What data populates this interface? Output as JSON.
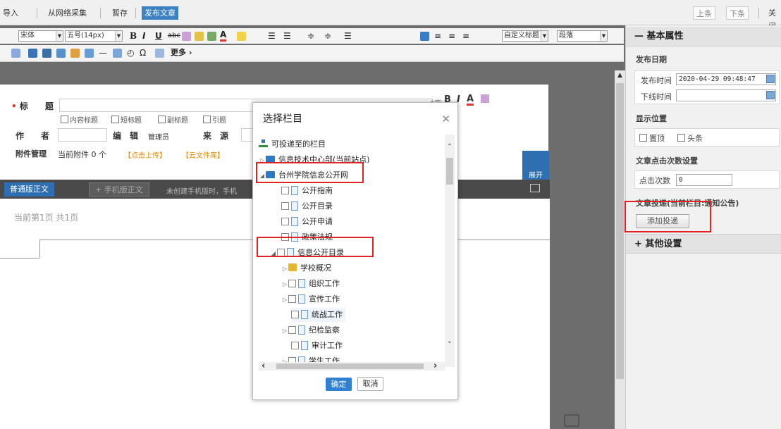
{
  "toolbar": {
    "import_label": "导入",
    "collect_label": "从网络采集",
    "draft_label": "暂存",
    "publish_label": "发布文章",
    "prev_label": "上条",
    "next_label": "下条",
    "close_label": "关闭"
  },
  "editor": {
    "font_family": "宋体",
    "font_size": "五号(14px)",
    "custom_title": "自定义标题",
    "paragraph": "段落",
    "more_label": "更多"
  },
  "meta": {
    "title_label": "标　　题",
    "title_tags": [
      "内容标题",
      "短标题",
      "副标题",
      "引题"
    ],
    "author_label": "作　　者",
    "editor_label": "编　辑",
    "editor_value": "管理员",
    "source_label": "来　源",
    "attach_label": "附件管理",
    "attach_current": "当前附件 0 个",
    "attach_upload": "【点击上传】",
    "attach_cloud": "【云文件库】",
    "expand_label": "展开"
  },
  "tabs": {
    "normal": "普通版正文",
    "mobile": "+ 手机版正文",
    "hint": "未创建手机版时，手机"
  },
  "page": {
    "page_info": "当前第1页  共1页"
  },
  "sidebar": {
    "basic_title": "基本属性",
    "publish_date_head": "发布日期",
    "publish_time_label": "发布时间",
    "publish_time_value": "2020-04-29 09:48:47",
    "offline_time_label": "下线时间",
    "display_head": "显示位置",
    "top_label": "置顶",
    "headline_label": "头条",
    "click_head": "文章点击次数设置",
    "click_label": "点击次数",
    "click_value": "0",
    "submit_head": "文章投递(当前栏目:通知公告)",
    "add_submit_label": "添加投递",
    "other_title": "其他设置"
  },
  "dialog": {
    "title": "选择栏目",
    "root": "可投递至的栏目",
    "nodes": [
      "信息技术中心部(当前站点)",
      "台州学院信息公开网",
      "公开指南",
      "公开目录",
      "公开申请",
      "政策法规",
      "信息公开目录",
      "学校概况",
      "组织工作",
      "宣传工作",
      "统战工作",
      "纪检监察",
      "审计工作",
      "学生工作"
    ],
    "ok_label": "确定",
    "cancel_label": "取消"
  }
}
